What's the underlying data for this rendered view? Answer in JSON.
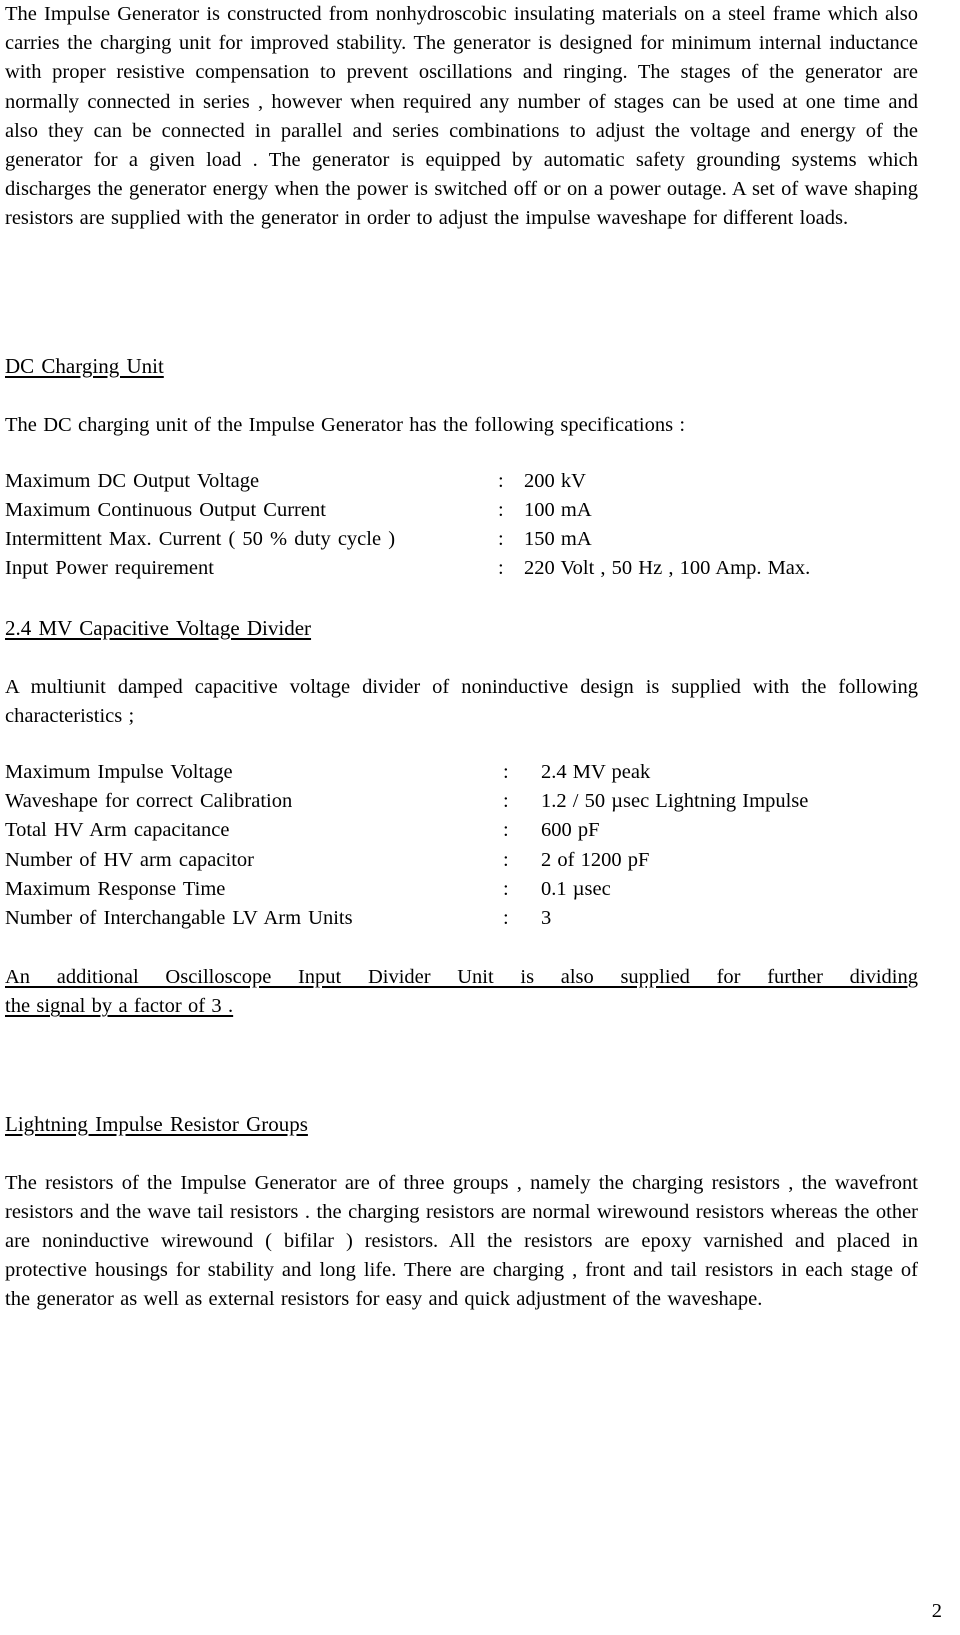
{
  "document": {
    "page_number": "2",
    "intro_paragraph": "The Impulse Generator is constructed from nonhydroscobic insulating materials on a steel frame which also carries the charging unit for improved stability. The generator is designed for minimum internal inductance with proper resistive compensation to prevent oscillations and ringing. The stages of the generator are normally connected in series , however when required any number of stages can be used at one time and also they can be connected in parallel and series combinations to adjust the voltage and energy of the generator for a given load . The generator is equipped by automatic safety grounding systems which discharges the generator energy when the power is switched off or on a power outage. A set of wave shaping resistors are supplied with the generator in order to adjust the impulse waveshape for different loads.",
    "sections": [
      {
        "heading": "DC  Charging Unit",
        "lead": "The DC  charging  unit  of the Impulse Generator  has the following  specifications :",
        "specs": [
          {
            "label": "Maximum  DC  Output   Voltage",
            "colon": ":",
            "value": "200   kV"
          },
          {
            "label": "Maximum  Continuous  Output Current",
            "colon": ":",
            "value": "100   mA"
          },
          {
            "label": "Intermittent  Max. Current ( 50 % duty cycle )",
            "colon": ":",
            "value": "150   mA"
          },
          {
            "label": "Input  Power requirement",
            "colon": ":",
            "value": "220 Volt , 50 Hz ,  100 Amp. Max."
          }
        ]
      },
      {
        "heading": "2.4 MV  Capacitive  Voltage Divider",
        "lead": "A multiunit  damped   capacitive  voltage divider of noninductive  design  is  supplied with the following  characteristics ;",
        "specs": [
          {
            "label": "Maximum  Impulse Voltage",
            "colon": ":",
            "value": "2.4  MV peak"
          },
          {
            "label": "Waveshape  for  correct  Calibration",
            "colon": ":",
            "value": "1.2 / 50  µsec     Lightning Impulse"
          },
          {
            "label": "Total  HV Arm capacitance",
            "colon": ":",
            "value": "600   pF"
          },
          {
            "label": "Number of  HV arm capacitor",
            "colon": ":",
            "value": "2    of  1200 pF"
          },
          {
            "label": "Maximum   Response  Time",
            "colon": ":",
            "value": "0.1  µsec"
          },
          {
            "label": "Number of  Interchangable  LV Arm Units",
            "colon": ":",
            "value": "3"
          }
        ],
        "note_line_1": "An additional  Oscilloscope  Input  Divider  Unit  is  also  supplied   for  further  dividing",
        "note_line_2": "the signal   by a  factor   of  3 ."
      },
      {
        "heading": "Lightning  Impulse Resistor Groups",
        "body": "The resistors of the  Impulse Generator   are  of  three groups ,  namely   the charging resistors , the wavefront  resistors   and   the wave  tail  resistors .  the charging   resistors are  normal  wirewound  resistors whereas   the other  are  noninductive  wirewound ( bifilar ) resistors. All  the  resistors  are   epoxy varnished  and  placed in  protective housings  for  stability and long  life. There  are  charging , front and tail resistors  in each  stage  of  the generator   as well  as  external  resistors   for  easy  and  quick adjustment  of the waveshape."
      }
    ]
  }
}
